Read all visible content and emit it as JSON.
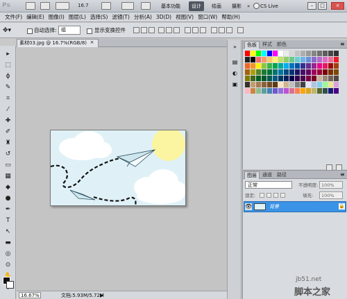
{
  "titlebar": {
    "zoom_value": "16.7",
    "workspaces": [
      "基本功能",
      "设计",
      "绘画",
      "摄影"
    ],
    "active_workspace": "设计",
    "more": "»",
    "cs_live": "CS Live",
    "win_min": "–",
    "win_max": "□",
    "win_close": "×"
  },
  "menu": [
    "文件(F)",
    "编辑(E)",
    "图像(I)",
    "图层(L)",
    "选择(S)",
    "滤镜(T)",
    "分析(A)",
    "3D(D)",
    "视图(V)",
    "窗口(W)",
    "帮助(H)"
  ],
  "options": {
    "auto_select_label": "自动选择:",
    "auto_select_value": "组",
    "show_transform_label": "显示变换控件"
  },
  "document": {
    "tab_title": "素材03.jpg @ 16.7%(RGB/8)",
    "tab_close": "×"
  },
  "status": {
    "zoom": "16.67%",
    "doc_size": "文档:5.93M/5.72M",
    "arrow": "▶"
  },
  "swatch_panel": {
    "tabs": [
      "色板",
      "样式",
      "颜色"
    ],
    "swatches": [
      "#ff0000",
      "#ffff00",
      "#00ff00",
      "#00ffff",
      "#0000ff",
      "#ff00ff",
      "#ffffff",
      "#ebebeb",
      "#d6d6d6",
      "#c2c2c2",
      "#adadad",
      "#999999",
      "#858585",
      "#707070",
      "#5c5c5c",
      "#474747",
      "#333333",
      "#1f1f1f",
      "#000000",
      "#f26b6b",
      "#f59b6b",
      "#fbc96b",
      "#fff46b",
      "#c6e06b",
      "#92cf6b",
      "#6bc98b",
      "#6bcfcf",
      "#6bb3e8",
      "#6b8fd6",
      "#8b6bc9",
      "#b46bc9",
      "#de6bc0",
      "#f06b9b",
      "#ee1c24",
      "#f26522",
      "#f7941d",
      "#fff200",
      "#8dc63f",
      "#39b54a",
      "#00a651",
      "#00a99d",
      "#00aeef",
      "#0072bc",
      "#0054a6",
      "#2e3192",
      "#662d91",
      "#92278f",
      "#ec008c",
      "#ed145b",
      "#9e0b0f",
      "#a0410d",
      "#a36209",
      "#aba000",
      "#598527",
      "#1a7b30",
      "#007236",
      "#00746b",
      "#0076a3",
      "#004a80",
      "#003471",
      "#1b1464",
      "#440e62",
      "#630460",
      "#9e005d",
      "#9e0039",
      "#790000",
      "#7b2e00",
      "#7d4900",
      "#827b00",
      "#406618",
      "#005e20",
      "#005826",
      "#005952",
      "#005b7f",
      "#003663",
      "#002157",
      "#0d004c",
      "#32004b",
      "#4b0049",
      "#7b0046",
      "#7a0026",
      "#c7b299",
      "#998675",
      "#736357",
      "#534741",
      "#37302a",
      "#c69c6d",
      "#a67c52",
      "#8c6239",
      "#754c24",
      "#603913",
      "#ffe4c4",
      "#d2b48c",
      "#c0c0c0",
      "#808080",
      "#404040",
      "#e6e6fa",
      "#b0c4de",
      "#87ceeb",
      "#98fb98",
      "#f0e68c",
      "#dda0dd",
      "#ffb6c1",
      "#cd853f",
      "#8fbc8f",
      "#5f9ea0",
      "#4682b4",
      "#6a5acd",
      "#9370db",
      "#ba55d3",
      "#db7093",
      "#ff7f50",
      "#ffa500",
      "#daa520",
      "#bdb76b",
      "#556b2f",
      "#2f4f4f",
      "#191970",
      "#4b0082"
    ]
  },
  "layers_panel": {
    "tabs": [
      "图层",
      "通道",
      "路径"
    ],
    "blend_mode": "正常",
    "opacity_label": "不透明度:",
    "opacity_value": "100%",
    "lock_label": "锁定:",
    "fill_label": "填充:",
    "fill_value": "100%",
    "layers": [
      {
        "name": "背景",
        "visible": true,
        "locked": true
      }
    ]
  },
  "watermark": {
    "url": "jb51.net",
    "name": "脚本之家"
  },
  "colors": {
    "selection_blue": "#3a93e6",
    "canvas_sky": "#dff1f7",
    "sun": "#fbf5a1"
  }
}
